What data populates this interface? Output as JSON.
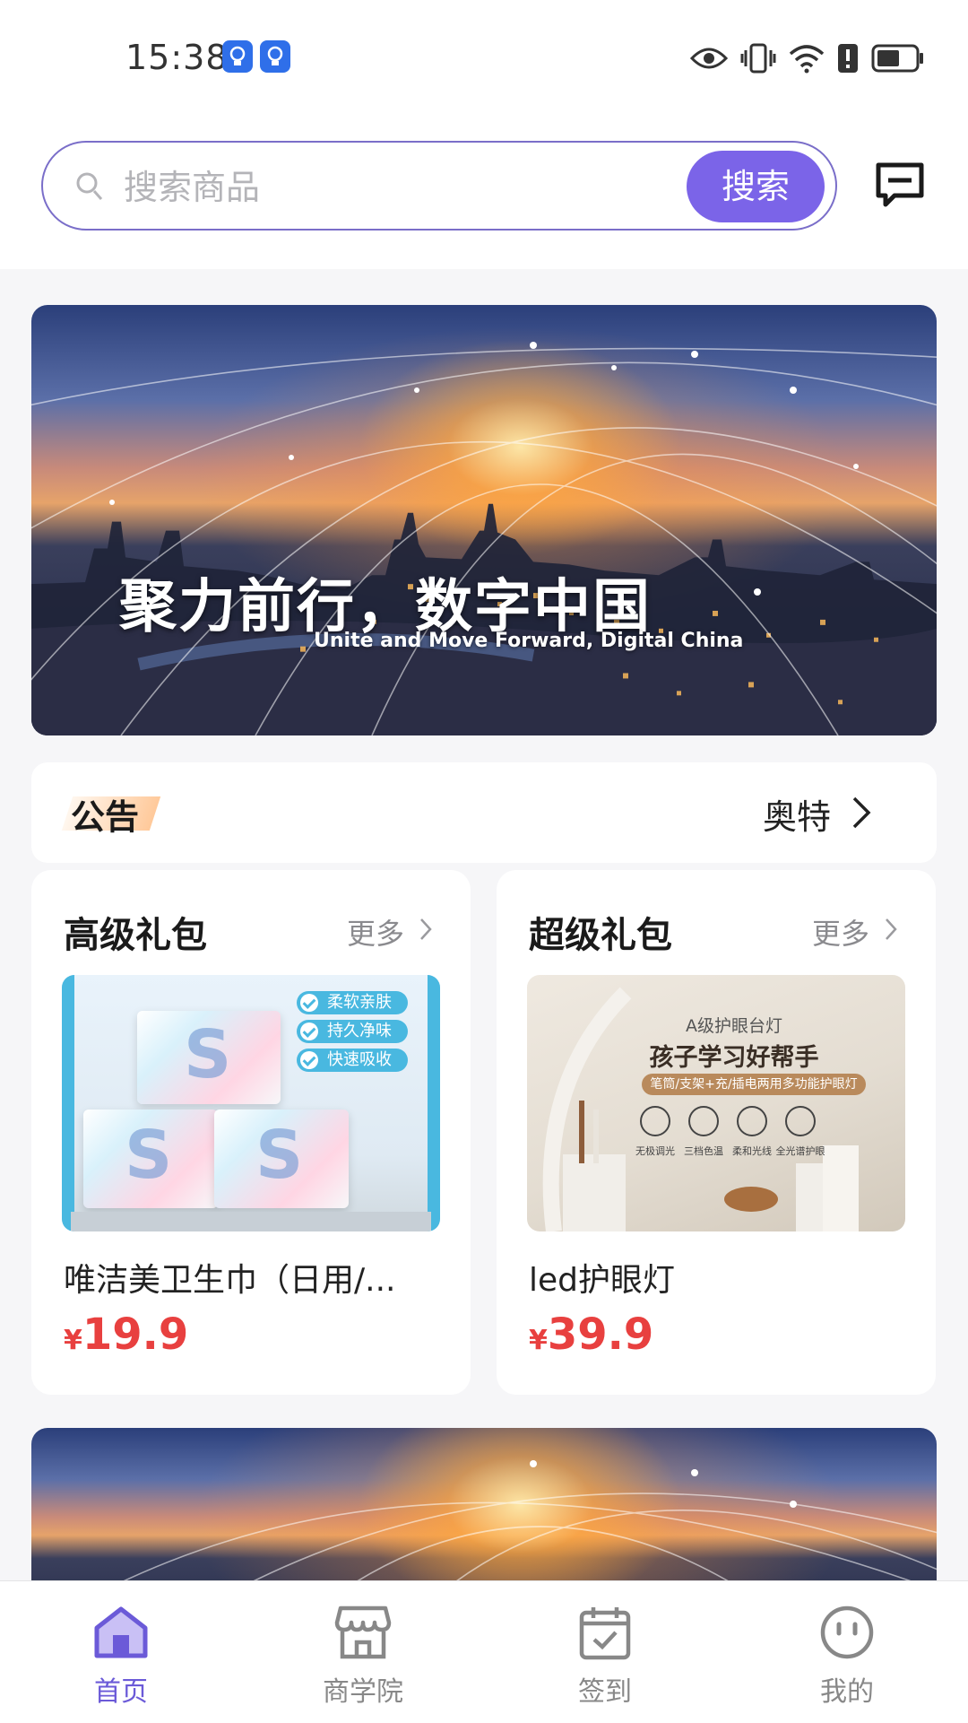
{
  "status_bar": {
    "time": "15:38",
    "notification_icons": [
      "bulb-icon",
      "bulb-icon"
    ],
    "system_icons": [
      "eye-icon",
      "vibrate-icon",
      "wifi-icon",
      "alert-icon",
      "battery-icon"
    ]
  },
  "search": {
    "placeholder": "搜索商品",
    "value": "",
    "button_label": "搜索",
    "message_icon": "message-icon"
  },
  "banner": {
    "title": "聚力前行，数字中国",
    "subtitle": "Unite and Move Forward, Digital China"
  },
  "notice": {
    "tag": "公告",
    "text": "奥特"
  },
  "cards": [
    {
      "title": "高级礼包",
      "more_label": "更多",
      "product": {
        "name": "唯洁美卫生巾（日用/...",
        "currency": "¥",
        "price": "19.9",
        "image_texts": [
          "柔软亲肤",
          "持久净味",
          "快速吸收"
        ]
      }
    },
    {
      "title": "超级礼包",
      "more_label": "更多",
      "product": {
        "name": "led护眼灯",
        "currency": "¥",
        "price": "39.9",
        "image_texts": {
          "line1": "A级护眼台灯",
          "line2": "孩子学习好帮手",
          "line3": "笔筒/支架+充/插电两用多功能护眼灯",
          "features": [
            "无极调光",
            "三档色温",
            "柔和光线",
            "全光谱护眼"
          ]
        }
      }
    }
  ],
  "tab_bar": {
    "active": "首页",
    "tabs": [
      {
        "label": "首页",
        "icon": "home-icon"
      },
      {
        "label": "商学院",
        "icon": "store-icon"
      },
      {
        "label": "签到",
        "icon": "calendar-check-icon"
      },
      {
        "label": "我的",
        "icon": "smiley-icon"
      }
    ]
  },
  "colors": {
    "accent": "#7b64e8",
    "price": "#e8403f",
    "active_tab": "#6b5ad8"
  }
}
